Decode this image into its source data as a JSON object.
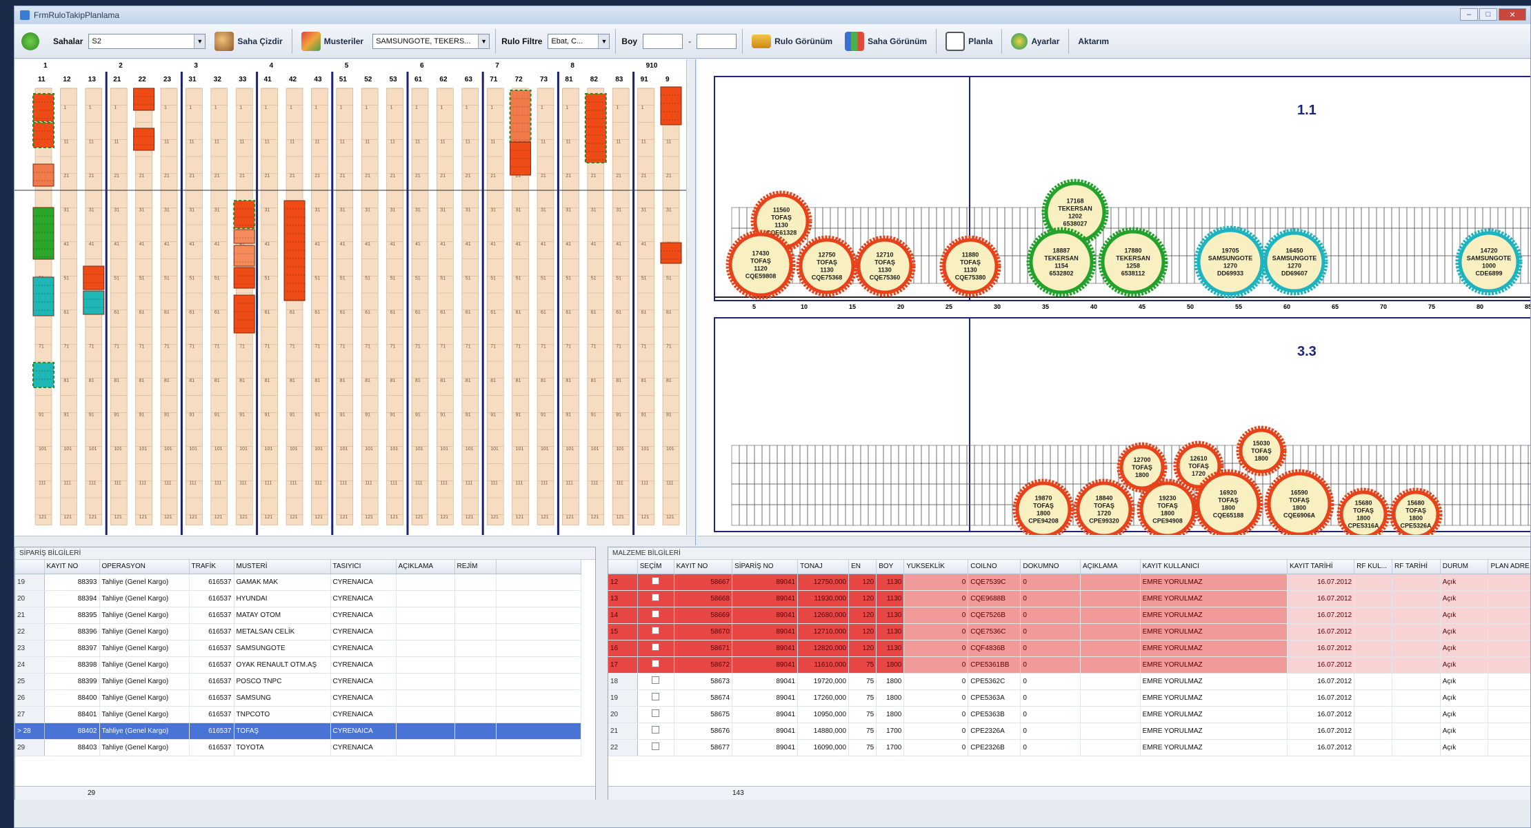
{
  "window": {
    "title": "FrmRuloTakipPlanlama",
    "minimize": "–",
    "maximize": "□",
    "close": "✕"
  },
  "toolbar": {
    "sahalar_label": "Sahalar",
    "sahalar_value": "S2",
    "saha_cizdir": "Saha Çizdir",
    "musteriler_label": "Musteriler",
    "musteriler_value": "SAMSUNGOTE, TEKERS...",
    "rulo_filtre_label": "Rulo Filtre",
    "rulo_filtre_value": "Ebat, C...",
    "boy_label": "Boy",
    "boy_sep": "-",
    "rulo_gorunum": "Rulo Görünüm",
    "saha_gorunum": "Saha Görünüm",
    "planla": "Planla",
    "ayarlar": "Ayarlar",
    "aktarım": "Aktarım"
  },
  "colors": {
    "accent": "#3a5fc8",
    "red": "#ee4b16",
    "green": "#2aa62a",
    "teal": "#1fb6b6",
    "lane": "#f6dcc0"
  },
  "lanes": {
    "group_labels": [
      "1",
      "2",
      "3",
      "4",
      "5",
      "6",
      "7",
      "8",
      "910"
    ],
    "column_labels": [
      "11",
      "12",
      "13",
      "21",
      "22",
      "23",
      "31",
      "32",
      "33",
      "41",
      "42",
      "43",
      "51",
      "52",
      "53",
      "61",
      "62",
      "63",
      "71",
      "72",
      "73",
      "81",
      "82",
      "83",
      "91",
      "9"
    ],
    "row_labels": [
      "1",
      "11",
      "21",
      "31",
      "41",
      "51",
      "61",
      "71",
      "81",
      "91",
      "101",
      "111",
      "121"
    ]
  },
  "right": {
    "section1_title": "1.1",
    "section1_axis": [
      "5",
      "10",
      "15",
      "20",
      "25",
      "30",
      "35",
      "40",
      "45",
      "50",
      "55",
      "60",
      "65",
      "70",
      "75",
      "80",
      "85"
    ],
    "section2_title": "3.3",
    "coils_top": [
      {
        "lines": [
          "11560",
          "TOFAŞ",
          "1130",
          "CQE61328"
        ],
        "color": "red"
      },
      {
        "lines": [
          "17430",
          "TOFAŞ",
          "1120",
          "CQE59808"
        ],
        "color": "red"
      },
      {
        "lines": [
          "12750",
          "TOFAŞ",
          "1130",
          "CQE75368"
        ],
        "color": "red"
      },
      {
        "lines": [
          "12710",
          "TOFAŞ",
          "1130",
          "CQE75360"
        ],
        "color": "red"
      },
      {
        "lines": [
          "11880",
          "TOFAŞ",
          "1130",
          "CQE75380"
        ],
        "color": "red"
      },
      {
        "lines": [
          "17168",
          "TEKERSAN",
          "1202",
          "6538027"
        ],
        "color": "green"
      },
      {
        "lines": [
          "18887",
          "TEKERSAN",
          "1154",
          "6532802"
        ],
        "color": "green"
      },
      {
        "lines": [
          "17880",
          "TEKERSAN",
          "1258",
          "6538112"
        ],
        "color": "green"
      },
      {
        "lines": [
          "19705",
          "SAMSUNGOTE",
          "1270",
          "DD69933"
        ],
        "color": "teal"
      },
      {
        "lines": [
          "16450",
          "SAMSUNGOTE",
          "1270",
          "DD69607"
        ],
        "color": "teal"
      },
      {
        "lines": [
          "14720",
          "SAMSUNGOTE",
          "1000",
          "CDE6899"
        ],
        "color": "teal"
      }
    ],
    "coils_bottom": [
      {
        "lines": [
          "12700",
          "TOFAŞ",
          "1800"
        ],
        "color": "red"
      },
      {
        "lines": [
          "12610",
          "TOFAŞ",
          "1720"
        ],
        "color": "red"
      },
      {
        "lines": [
          "15030",
          "TOFAŞ",
          "1800"
        ],
        "color": "red"
      },
      {
        "lines": [
          "19870",
          "TOFAŞ",
          "1800",
          "CPE94208"
        ],
        "color": "red"
      },
      {
        "lines": [
          "18840",
          "TOFAŞ",
          "1720",
          "CPE99320"
        ],
        "color": "red"
      },
      {
        "lines": [
          "19230",
          "TOFAŞ",
          "1800",
          "CPE94908"
        ],
        "color": "red"
      },
      {
        "lines": [
          "16920",
          "TOFAŞ",
          "1800",
          "CQE65188"
        ],
        "color": "red"
      },
      {
        "lines": [
          "16590",
          "TOFAŞ",
          "1800",
          "CQE6906A"
        ],
        "color": "red"
      },
      {
        "lines": [
          "15680",
          "TOFAŞ",
          "1800",
          "CPE5316A"
        ],
        "color": "red"
      },
      {
        "lines": [
          "15680",
          "TOFAŞ",
          "1800",
          "CPE5326A"
        ],
        "color": "red"
      }
    ]
  },
  "siparis": {
    "header": "SİPARİŞ BİLGİLERİ",
    "columns": [
      "KAYIT NO",
      "OPERASYON",
      "TRAFİK",
      "MUSTERİ",
      "TASIYICI",
      "AÇIKLAMA",
      "REJİM"
    ],
    "rows": [
      {
        "rn": "19",
        "kayit": "88393",
        "op": "Tahliye (Genel Kargo)",
        "trafik": "616537",
        "musteri": "GAMAK MAK",
        "tasiyici": "CYRENAICA"
      },
      {
        "rn": "20",
        "kayit": "88394",
        "op": "Tahliye (Genel Kargo)",
        "trafik": "616537",
        "musteri": "HYUNDAI",
        "tasiyici": "CYRENAICA"
      },
      {
        "rn": "21",
        "kayit": "88395",
        "op": "Tahliye (Genel Kargo)",
        "trafik": "616537",
        "musteri": "MATAY OTOM",
        "tasiyici": "CYRENAICA"
      },
      {
        "rn": "22",
        "kayit": "88396",
        "op": "Tahliye (Genel Kargo)",
        "trafik": "616537",
        "musteri": "METALSAN CELİK",
        "tasiyici": "CYRENAICA"
      },
      {
        "rn": "23",
        "kayit": "88397",
        "op": "Tahliye (Genel Kargo)",
        "trafik": "616537",
        "musteri": "SAMSUNGOTE",
        "tasiyici": "CYRENAICA"
      },
      {
        "rn": "24",
        "kayit": "88398",
        "op": "Tahliye (Genel Kargo)",
        "trafik": "616537",
        "musteri": "OYAK RENAULT OTM.AŞ",
        "tasiyici": "CYRENAICA"
      },
      {
        "rn": "25",
        "kayit": "88399",
        "op": "Tahliye (Genel Kargo)",
        "trafik": "616537",
        "musteri": "POSCO TNPC",
        "tasiyici": "CYRENAICA"
      },
      {
        "rn": "26",
        "kayit": "88400",
        "op": "Tahliye (Genel Kargo)",
        "trafik": "616537",
        "musteri": "SAMSUNG",
        "tasiyici": "CYRENAICA"
      },
      {
        "rn": "27",
        "kayit": "88401",
        "op": "Tahliye (Genel Kargo)",
        "trafik": "616537",
        "musteri": "TNPCOTO",
        "tasiyici": "CYRENAICA"
      },
      {
        "rn": "> 28",
        "kayit": "88402",
        "op": "Tahliye (Genel Kargo)",
        "trafik": "616537",
        "musteri": "TOFAŞ",
        "tasiyici": "CYRENAICA"
      },
      {
        "rn": "29",
        "kayit": "88403",
        "op": "Tahliye (Genel Kargo)",
        "trafik": "616537",
        "musteri": "TOYOTA",
        "tasiyici": "CYRENAICA"
      }
    ],
    "footer_count": "29"
  },
  "malzeme": {
    "header": "MALZEME BİLGİLERİ",
    "columns": [
      "SEÇİM",
      "KAYIT NO",
      "SİPARİŞ NO",
      "TONAJ",
      "EN",
      "BOY",
      "YUKSEKLİK",
      "COILNO",
      "DOKUMNO",
      "AÇIKLAMA",
      "KAYIT KULLANICI",
      "KAYIT TARİHİ",
      "RF KUL...",
      "RF TARİHİ",
      "DURUM",
      "PLAN ADRE"
    ],
    "rows": [
      {
        "rn": "12",
        "kayit": "58667",
        "siparis": "89041",
        "tonaj": "12750,000",
        "en": "120",
        "boy": "1130",
        "yuk": "0",
        "coil": "CQE7539C",
        "dokum": "0",
        "kullanici": "EMRE YORULMAZ",
        "tarih": "16.07.2012",
        "durum": "Açık",
        "red": true
      },
      {
        "rn": "13",
        "kayit": "58668",
        "siparis": "89041",
        "tonaj": "11930,000",
        "en": "120",
        "boy": "1130",
        "yuk": "0",
        "coil": "CQE9688B",
        "dokum": "0",
        "kullanici": "EMRE YORULMAZ",
        "tarih": "16.07.2012",
        "durum": "Açık",
        "red": true
      },
      {
        "rn": "14",
        "kayit": "58669",
        "siparis": "89041",
        "tonaj": "12680,000",
        "en": "120",
        "boy": "1130",
        "yuk": "0",
        "coil": "CQE7526B",
        "dokum": "0",
        "kullanici": "EMRE YORULMAZ",
        "tarih": "16.07.2012",
        "durum": "Açık",
        "red": true
      },
      {
        "rn": "15",
        "kayit": "58670",
        "siparis": "89041",
        "tonaj": "12710,000",
        "en": "120",
        "boy": "1130",
        "yuk": "0",
        "coil": "CQE7536C",
        "dokum": "0",
        "kullanici": "EMRE YORULMAZ",
        "tarih": "16.07.2012",
        "durum": "Açık",
        "red": true
      },
      {
        "rn": "16",
        "kayit": "58671",
        "siparis": "89041",
        "tonaj": "12820,000",
        "en": "120",
        "boy": "1130",
        "yuk": "0",
        "coil": "CQF4836B",
        "dokum": "0",
        "kullanici": "EMRE YORULMAZ",
        "tarih": "16.07.2012",
        "durum": "Açık",
        "red": true
      },
      {
        "rn": "17",
        "kayit": "58672",
        "siparis": "89041",
        "tonaj": "11610,000",
        "en": "75",
        "boy": "1800",
        "yuk": "0",
        "coil": "CPE5361BB",
        "dokum": "0",
        "kullanici": "EMRE YORULMAZ",
        "tarih": "16.07.2012",
        "durum": "Açık",
        "red": true
      },
      {
        "rn": "18",
        "kayit": "58673",
        "siparis": "89041",
        "tonaj": "19720,000",
        "en": "75",
        "boy": "1800",
        "yuk": "0",
        "coil": "CPE5362C",
        "dokum": "0",
        "kullanici": "EMRE YORULMAZ",
        "tarih": "16.07.2012",
        "durum": "Açık",
        "red": false
      },
      {
        "rn": "19",
        "kayit": "58674",
        "siparis": "89041",
        "tonaj": "17260,000",
        "en": "75",
        "boy": "1800",
        "yuk": "0",
        "coil": "CPE5363A",
        "dokum": "0",
        "kullanici": "EMRE YORULMAZ",
        "tarih": "16.07.2012",
        "durum": "Açık",
        "red": false
      },
      {
        "rn": "20",
        "kayit": "58675",
        "siparis": "89041",
        "tonaj": "10950,000",
        "en": "75",
        "boy": "1800",
        "yuk": "0",
        "coil": "CPE5363B",
        "dokum": "0",
        "kullanici": "EMRE YORULMAZ",
        "tarih": "16.07.2012",
        "durum": "Açık",
        "red": false
      },
      {
        "rn": "21",
        "kayit": "58676",
        "siparis": "89041",
        "tonaj": "14880,000",
        "en": "75",
        "boy": "1700",
        "yuk": "0",
        "coil": "CPE2326A",
        "dokum": "0",
        "kullanici": "EMRE YORULMAZ",
        "tarih": "16.07.2012",
        "durum": "Açık",
        "red": false
      },
      {
        "rn": "22",
        "kayit": "58677",
        "siparis": "89041",
        "tonaj": "16090,000",
        "en": "75",
        "boy": "1700",
        "yuk": "0",
        "coil": "CPE2326B",
        "dokum": "0",
        "kullanici": "EMRE YORULMAZ",
        "tarih": "16.07.2012",
        "durum": "Açık",
        "red": false
      }
    ],
    "footer_count": "143"
  }
}
